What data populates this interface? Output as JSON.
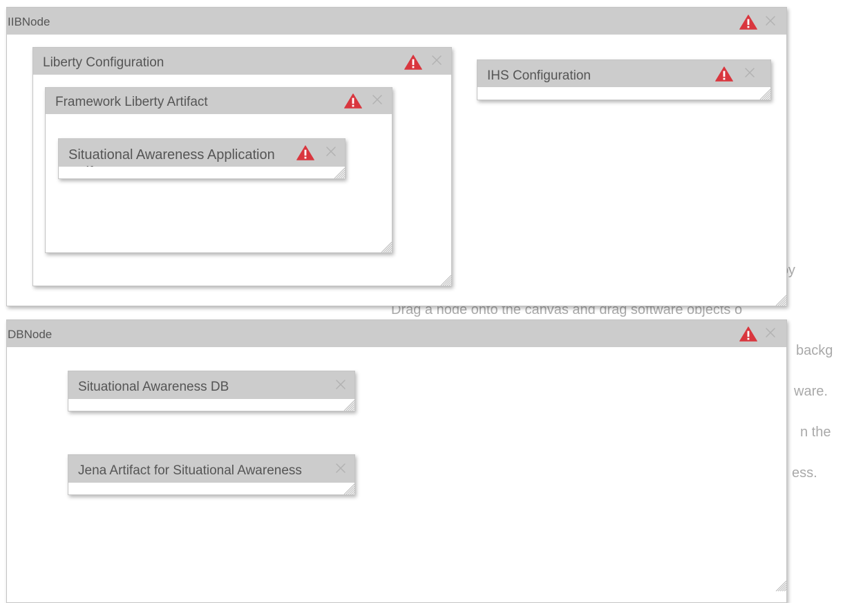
{
  "background_text": {
    "lines": [
      "deploy",
      "Drag a node onto the canvas and drag software objects o",
      "backg",
      "ware.",
      "n the",
      "ess."
    ]
  },
  "nodes": {
    "iib": {
      "title": "IIBNode",
      "liberty": {
        "title": "Liberty Configuration",
        "framework": {
          "title": "Framework Liberty Artifact",
          "situational_app": {
            "title": "Situational Awareness Application Artifact"
          }
        }
      },
      "ihs": {
        "title": "IHS Configuration"
      }
    },
    "db": {
      "title": "DBNode",
      "situational_db": {
        "title": "Situational Awareness DB"
      },
      "jena": {
        "title": "Jena Artifact for Situational Awareness"
      }
    }
  },
  "icons": {
    "warning": "warning-icon",
    "close": "close-icon",
    "resize": "resize-handle-icon"
  },
  "colors": {
    "warning": "#d9363e",
    "header_bg": "#cccccc",
    "panel_border": "#c4c4c4",
    "close_x": "#b2b2b2",
    "background_text": "#a9a9a9"
  }
}
